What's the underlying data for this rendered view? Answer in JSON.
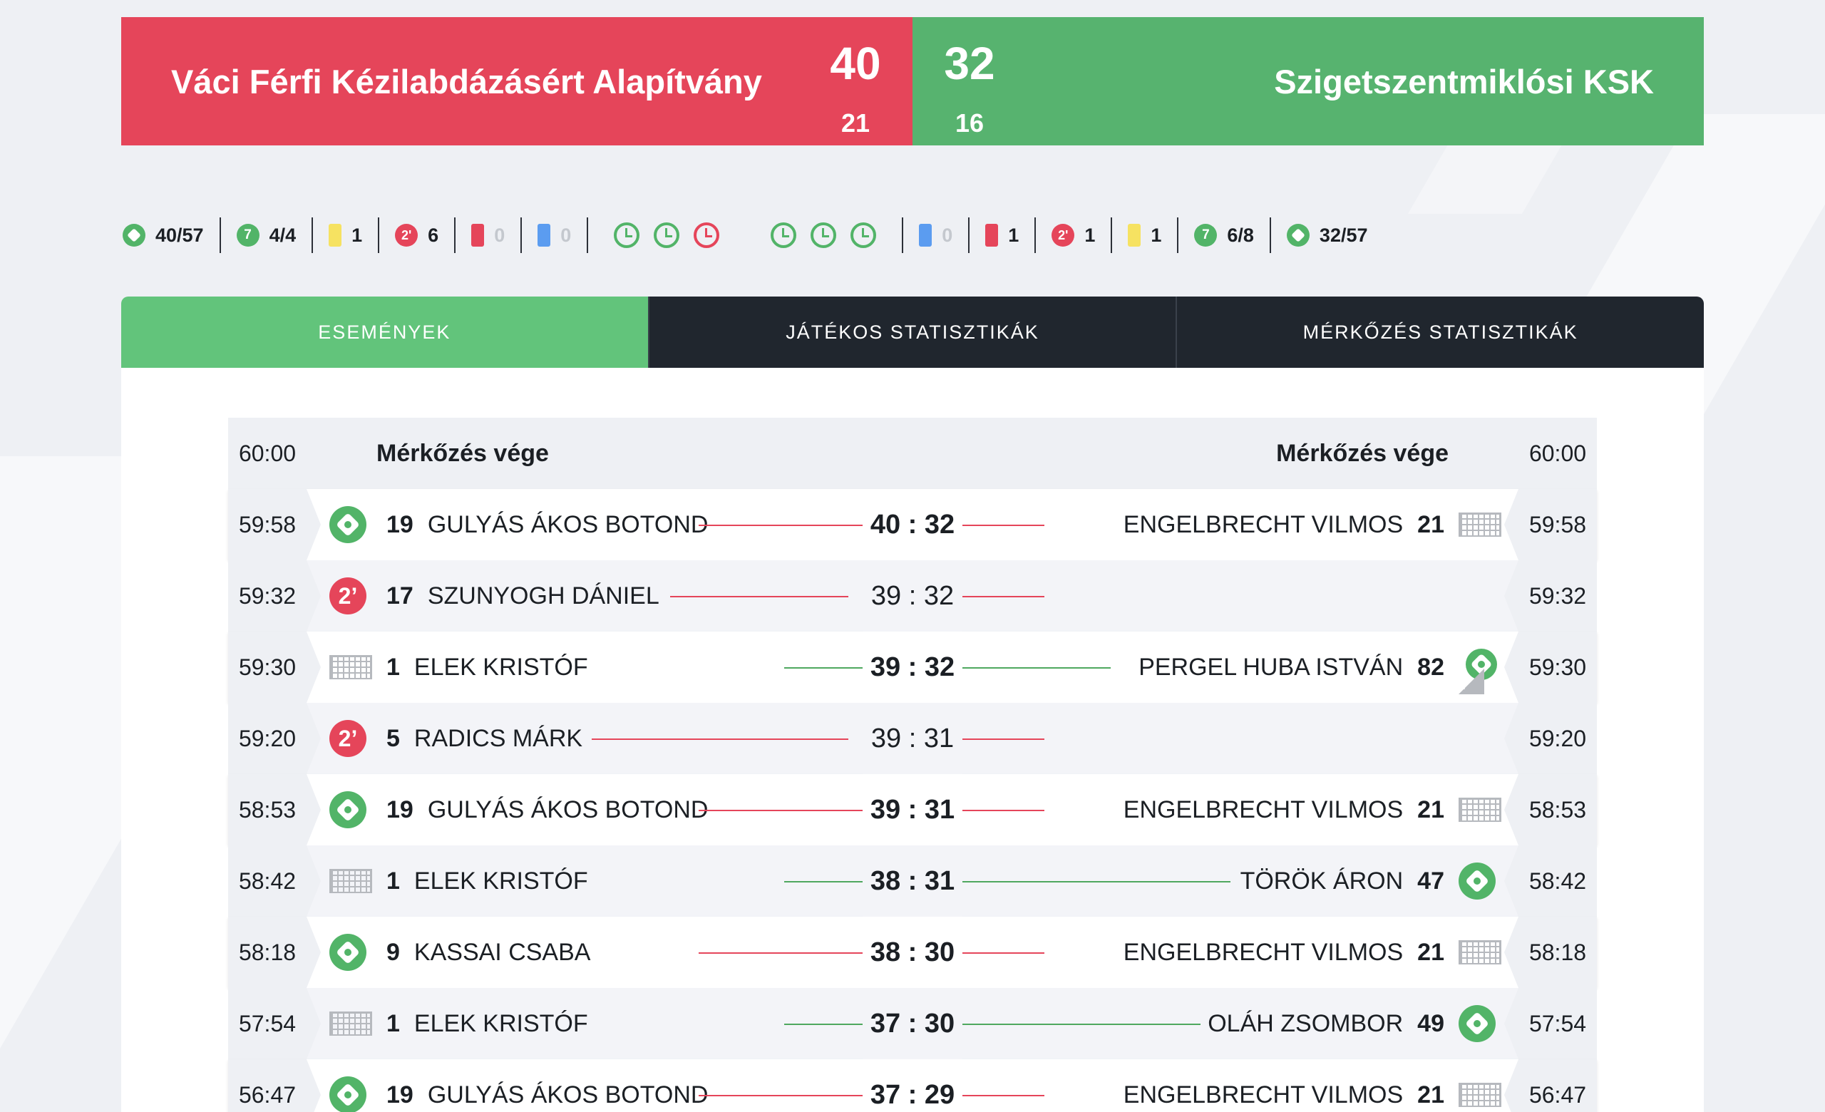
{
  "match": {
    "home": {
      "name": "Váci Férfi Kézilabdázásért Alapítvány",
      "score": "40",
      "half": "21",
      "color": "#e5455a"
    },
    "away": {
      "name": "Szigetszentmiklósi KSK",
      "score": "32",
      "half": "16",
      "color": "#57b36f"
    }
  },
  "stats": {
    "home": {
      "goals": "40/57",
      "sevens": "4/4",
      "yellow": "1",
      "twomin": "6",
      "red": "0",
      "blue": "0"
    },
    "away": {
      "goals": "32/57",
      "sevens": "6/8",
      "yellow": "1",
      "twomin": "1",
      "red": "1",
      "blue": "0"
    },
    "timeouts_home": [
      "green",
      "green",
      "red"
    ],
    "timeouts_away": [
      "green",
      "green",
      "green"
    ]
  },
  "tabs": [
    "ESEMÉNYEK",
    "JÁTÉKOS STATISZTIKÁK",
    "MÉRKŐZÉS STATISZTIKÁK"
  ],
  "events": {
    "end": {
      "time": "60:00",
      "label": "Mérkőzés vége"
    },
    "rows": [
      {
        "time": "59:58",
        "left_icon": "ball-icon",
        "left_num": "19",
        "left_name": "GULYÁS ÁKOS BOTOND",
        "score": "40 : 32",
        "right_name": "ENGELBRECHT VILMOS",
        "right_num": "21",
        "right_icon": "goal-net-icon"
      },
      {
        "time": "59:32",
        "left_icon": "two-minute-icon",
        "left_num": "17",
        "left_name": "SZUNYOGH DÁNIEL",
        "score": "39 : 32",
        "right_name": "",
        "right_num": "",
        "right_icon": ""
      },
      {
        "time": "59:30",
        "left_icon": "goal-net-icon",
        "left_num": "1",
        "left_name": "ELEK KRISTÓF",
        "score": "39 : 32",
        "right_name": "PERGEL HUBA ISTVÁN",
        "right_num": "82",
        "right_icon": "seven-meter-goal-icon"
      },
      {
        "time": "59:20",
        "left_icon": "two-minute-icon",
        "left_num": "5",
        "left_name": "RADICS MÁRK",
        "score": "39 : 31",
        "right_name": "",
        "right_num": "",
        "right_icon": ""
      },
      {
        "time": "58:53",
        "left_icon": "ball-icon",
        "left_num": "19",
        "left_name": "GULYÁS ÁKOS BOTOND",
        "score": "39 : 31",
        "right_name": "ENGELBRECHT VILMOS",
        "right_num": "21",
        "right_icon": "goal-net-icon"
      },
      {
        "time": "58:42",
        "left_icon": "goal-net-icon",
        "left_num": "1",
        "left_name": "ELEK KRISTÓF",
        "score": "38 : 31",
        "right_name": "TÖRÖK ÁRON",
        "right_num": "47",
        "right_icon": "ball-icon"
      },
      {
        "time": "58:18",
        "left_icon": "ball-icon",
        "left_num": "9",
        "left_name": "KASSAI CSABA",
        "score": "38 : 30",
        "right_name": "ENGELBRECHT VILMOS",
        "right_num": "21",
        "right_icon": "goal-net-icon"
      },
      {
        "time": "57:54",
        "left_icon": "goal-net-icon",
        "left_num": "1",
        "left_name": "ELEK KRISTÓF",
        "score": "37 : 30",
        "right_name": "OLÁH ZSOMBOR",
        "right_num": "49",
        "right_icon": "ball-icon"
      },
      {
        "time": "56:47",
        "left_icon": "ball-icon",
        "left_num": "19",
        "left_name": "GULYÁS ÁKOS BOTOND",
        "score": "37 : 29",
        "right_name": "ENGELBRECHT VILMOS",
        "right_num": "21",
        "right_icon": "goal-net-icon"
      }
    ]
  }
}
